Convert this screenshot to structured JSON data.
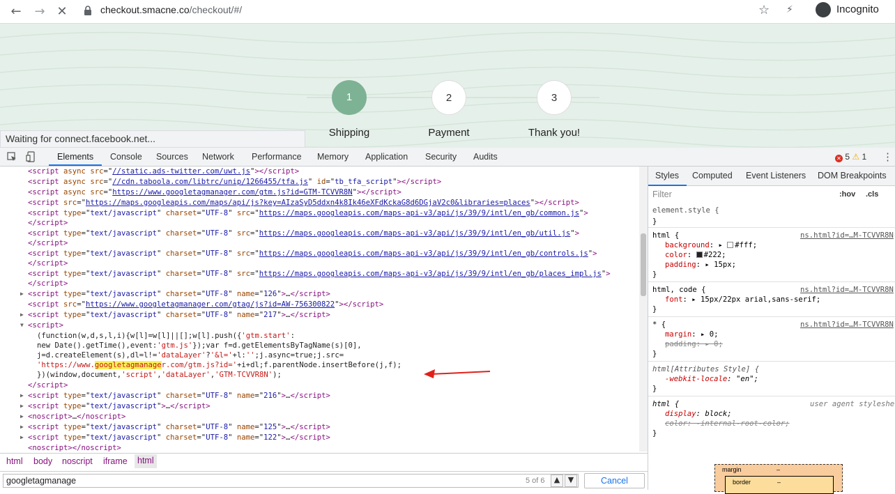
{
  "browser": {
    "url_host": "checkout.smacne.co",
    "url_path": "/checkout/#/",
    "incognito_label": "Incognito",
    "back_icon": "←",
    "forward_icon": "→",
    "reload_icon": "✕",
    "star_icon": "☆",
    "bolt_icon": "⚡"
  },
  "page": {
    "steps": [
      {
        "num": "1",
        "label": "Shipping"
      },
      {
        "num": "2",
        "label": "Payment"
      },
      {
        "num": "3",
        "label": "Thank you!"
      }
    ],
    "status_text": "Waiting for connect.facebook.net..."
  },
  "devtools": {
    "tabs": [
      "Elements",
      "Console",
      "Sources",
      "Network",
      "Performance",
      "Memory",
      "Application",
      "Security",
      "Audits"
    ],
    "errors": "5",
    "warnings": "1",
    "code_lines": [
      {
        "i": 0,
        "html": "<span class='t'>&lt;script</span> <span class='a'>async</span> <span class='a'>src</span>=\"<span class='u'>//static.ads-twitter.com/uwt.js</span>\"<span class='t'>&gt;&lt;/script&gt;</span>"
      },
      {
        "i": 0,
        "html": "<span class='t'>&lt;script</span> <span class='a'>async</span> <span class='a'>src</span>=\"<span class='u'>//cdn.taboola.com/libtrc/unip/1266455/tfa.js</span>\" <span class='a'>id</span>=\"<span class='v'>tb_tfa_script</span>\"<span class='t'>&gt;&lt;/script&gt;</span>"
      },
      {
        "i": 0,
        "html": "<span class='t'>&lt;script</span> <span class='a'>async</span> <span class='a'>src</span>=\"<span class='u'>https://www.googletagmanager.com/gtm.js?id=GTM-TCVVR8N</span>\"<span class='t'>&gt;&lt;/script&gt;</span>"
      },
      {
        "i": 0,
        "html": "<span class='t'>&lt;script</span> <span class='a'>src</span>=\"<span class='u'>https://maps.googleapis.com/maps/api/js?key=AIzaSyD5ddxn4k8Ik46eXFdKckaG8d6DGjaV2c0&amp;libraries=places</span>\"<span class='t'>&gt;&lt;/script&gt;</span>"
      },
      {
        "i": 0,
        "html": "<span class='t'>&lt;script</span> <span class='a'>type</span>=\"<span class='v'>text/javascript</span>\" <span class='a'>charset</span>=\"<span class='v'>UTF-8</span>\" <span class='a'>src</span>=\"<span class='u'>https://maps.googleapis.com/maps-api-v3/api/js/39/9/intl/en_gb/common.js</span>\"<span class='t'>&gt;</span>"
      },
      {
        "i": 0,
        "html": "<span class='t'>&lt;/script&gt;</span>"
      },
      {
        "i": 0,
        "html": "<span class='t'>&lt;script</span> <span class='a'>type</span>=\"<span class='v'>text/javascript</span>\" <span class='a'>charset</span>=\"<span class='v'>UTF-8</span>\" <span class='a'>src</span>=\"<span class='u'>https://maps.googleapis.com/maps-api-v3/api/js/39/9/intl/en_gb/util.js</span>\"<span class='t'>&gt;</span>"
      },
      {
        "i": 0,
        "html": "<span class='t'>&lt;/script&gt;</span>"
      },
      {
        "i": 0,
        "html": "<span class='t'>&lt;script</span> <span class='a'>type</span>=\"<span class='v'>text/javascript</span>\" <span class='a'>charset</span>=\"<span class='v'>UTF-8</span>\" <span class='a'>src</span>=\"<span class='u'>https://maps.googleapis.com/maps-api-v3/api/js/39/9/intl/en_gb/controls.js</span>\"<span class='t'>&gt;</span>"
      },
      {
        "i": 0,
        "html": "<span class='t'>&lt;/script&gt;</span>"
      },
      {
        "i": 0,
        "html": "<span class='t'>&lt;script</span> <span class='a'>type</span>=\"<span class='v'>text/javascript</span>\" <span class='a'>charset</span>=\"<span class='v'>UTF-8</span>\" <span class='a'>src</span>=\"<span class='u'>https://maps.googleapis.com/maps-api-v3/api/js/39/9/intl/en_gb/places_impl.js</span>\"<span class='t'>&gt;</span>"
      },
      {
        "i": 0,
        "html": "<span class='t'>&lt;/script&gt;</span>"
      },
      {
        "i": 0,
        "tri": "▶",
        "html": "<span class='t'>&lt;script</span> <span class='a'>type</span>=\"<span class='v'>text/javascript</span>\" <span class='a'>charset</span>=\"<span class='v'>UTF-8</span>\" <span class='a'>name</span>=\"<span class='v'>126</span>\"<span class='t'>&gt;</span>…<span class='t'>&lt;/script&gt;</span>"
      },
      {
        "i": 0,
        "html": "<span class='t'>&lt;script</span> <span class='a'>src</span>=\"<span class='u'>https://www.googletagmanager.com/gtag/js?id=AW-756300822</span>\"<span class='t'>&gt;&lt;/script&gt;</span>"
      },
      {
        "i": 0,
        "tri": "▶",
        "html": "<span class='t'>&lt;script</span> <span class='a'>type</span>=\"<span class='v'>text/javascript</span>\" <span class='a'>charset</span>=\"<span class='v'>UTF-8</span>\" <span class='a'>name</span>=\"<span class='v'>217</span>\"<span class='t'>&gt;</span>…<span class='t'>&lt;/script&gt;</span>"
      },
      {
        "i": 0,
        "tri": "▼",
        "html": "<span class='t'>&lt;script&gt;</span>"
      },
      {
        "i": 1,
        "html": "(function(w,d,s,l,i){w[l]=w[l]||[];w[l].push({<span class='s'>'gtm.start'</span>:"
      },
      {
        "i": 1,
        "html": "new Date().getTime(),event:<span class='s'>'gtm.js'</span>});var f=d.getElementsByTagName(s)[0],"
      },
      {
        "i": 1,
        "html": "j=d.createElement(s),dl=l!=<span class='s'>'dataLayer'</span>?<span class='s'>'&amp;l='</span>+l:<span class='s'>''</span>;j.async=true;j.src="
      },
      {
        "i": 1,
        "html": "<span class='s'>'https://www.<span class='hl'>googletagmanage</span>r.com/gtm.js?id='</span>+i+dl;f.parentNode.insertBefore(j,f);"
      },
      {
        "i": 1,
        "html": "})(window,document,<span class='s'>'script'</span>,<span class='s'>'dataLayer'</span>,<span class='s'>'GTM-TCVVR8N'</span>);"
      },
      {
        "i": 0,
        "html": "<span class='t'>&lt;/script&gt;</span>"
      },
      {
        "i": 0,
        "tri": "▶",
        "html": "<span class='t'>&lt;script</span> <span class='a'>type</span>=\"<span class='v'>text/javascript</span>\" <span class='a'>charset</span>=\"<span class='v'>UTF-8</span>\" <span class='a'>name</span>=\"<span class='v'>216</span>\"<span class='t'>&gt;</span>…<span class='t'>&lt;/script&gt;</span>"
      },
      {
        "i": 0,
        "tri": "▶",
        "html": "<span class='t'>&lt;script</span> <span class='a'>type</span>=\"<span class='v'>text/javascript</span>\"<span class='t'>&gt;</span>…<span class='t'>&lt;/script&gt;</span>"
      },
      {
        "i": 0,
        "tri": "▶",
        "html": "<span class='t'>&lt;noscript&gt;</span>…<span class='t'>&lt;/noscript&gt;</span>"
      },
      {
        "i": 0,
        "tri": "▶",
        "html": "<span class='t'>&lt;script</span> <span class='a'>type</span>=\"<span class='v'>text/javascript</span>\" <span class='a'>charset</span>=\"<span class='v'>UTF-8</span>\" <span class='a'>name</span>=\"<span class='v'>125</span>\"<span class='t'>&gt;</span>…<span class='t'>&lt;/script&gt;</span>"
      },
      {
        "i": 0,
        "tri": "▶",
        "html": "<span class='t'>&lt;script</span> <span class='a'>type</span>=\"<span class='v'>text/javascript</span>\" <span class='a'>charset</span>=\"<span class='v'>UTF-8</span>\" <span class='a'>name</span>=\"<span class='v'>122</span>\"<span class='t'>&gt;</span>…<span class='t'>&lt;/script&gt;</span>"
      },
      {
        "i": 0,
        "html": "<span class='t'>&lt;noscript&gt;&lt;/noscript&gt;</span>"
      }
    ],
    "breadcrumbs": [
      "html",
      "body",
      "noscript",
      "iframe",
      "html"
    ],
    "search": {
      "value": "googletagmanage",
      "count": "5 of 6",
      "cancel": "Cancel"
    },
    "styles_tabs": [
      "Styles",
      "Computed",
      "Event Listeners",
      "DOM Breakpoints"
    ],
    "filter_placeholder": "Filter",
    "hov": ":hov",
    "cls": ".cls",
    "box_margin": "margin",
    "box_border": "border",
    "box_dash": "–"
  }
}
